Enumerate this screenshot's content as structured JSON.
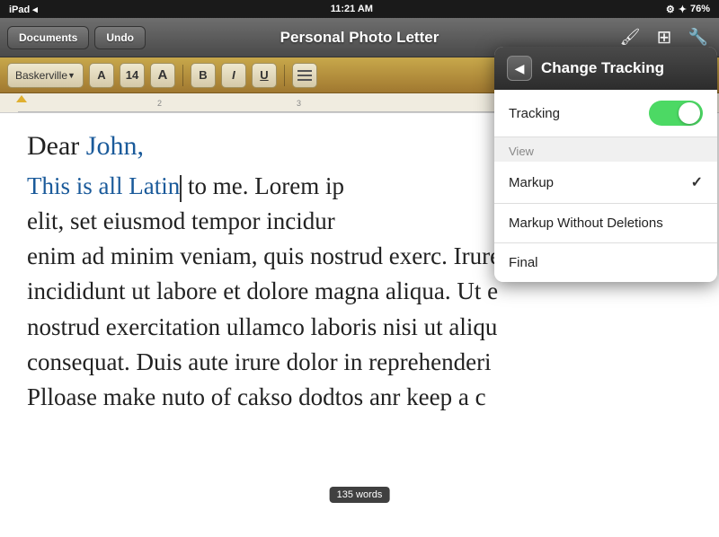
{
  "statusBar": {
    "time": "11:21 AM",
    "battery": "76%",
    "signal": "iPad ◂"
  },
  "navBar": {
    "documentsLabel": "Documents",
    "undoLabel": "Undo",
    "title": "Personal Photo Letter"
  },
  "toolbar": {
    "font": "Baskerville",
    "fontSize": "14",
    "boldLabel": "B",
    "italicLabel": "I",
    "underlineLabel": "U"
  },
  "document": {
    "greeting": "Dear ",
    "name": "John,",
    "trackedText": "This is all Latin",
    "bodyAfterCursor": " to me. Lorem ip",
    "body1": "elit, set eiusmod tempor incidur",
    "body2": "enim ad minim veniam, quis nostrud exerc. Irure",
    "body3": "incididunt ut labore et dolore magna aliqua. Ut e",
    "body4": "nostrud exercitation ullamco laboris nisi ut aliqu",
    "body5": "consequat. Duis aute irure dolor in reprehenderi",
    "body6": "Plloase make nuto of cakso dodtos anr keep a c",
    "wordCount": "135 words"
  },
  "changeTrackingPanel": {
    "title": "Change Tracking",
    "backLabel": "◀",
    "trackingLabel": "Tracking",
    "toggleState": "ON",
    "viewLabel": "View",
    "menuItems": [
      {
        "label": "Markup",
        "selected": true
      },
      {
        "label": "Markup Without Deletions",
        "selected": false
      },
      {
        "label": "Final",
        "selected": false
      }
    ]
  }
}
